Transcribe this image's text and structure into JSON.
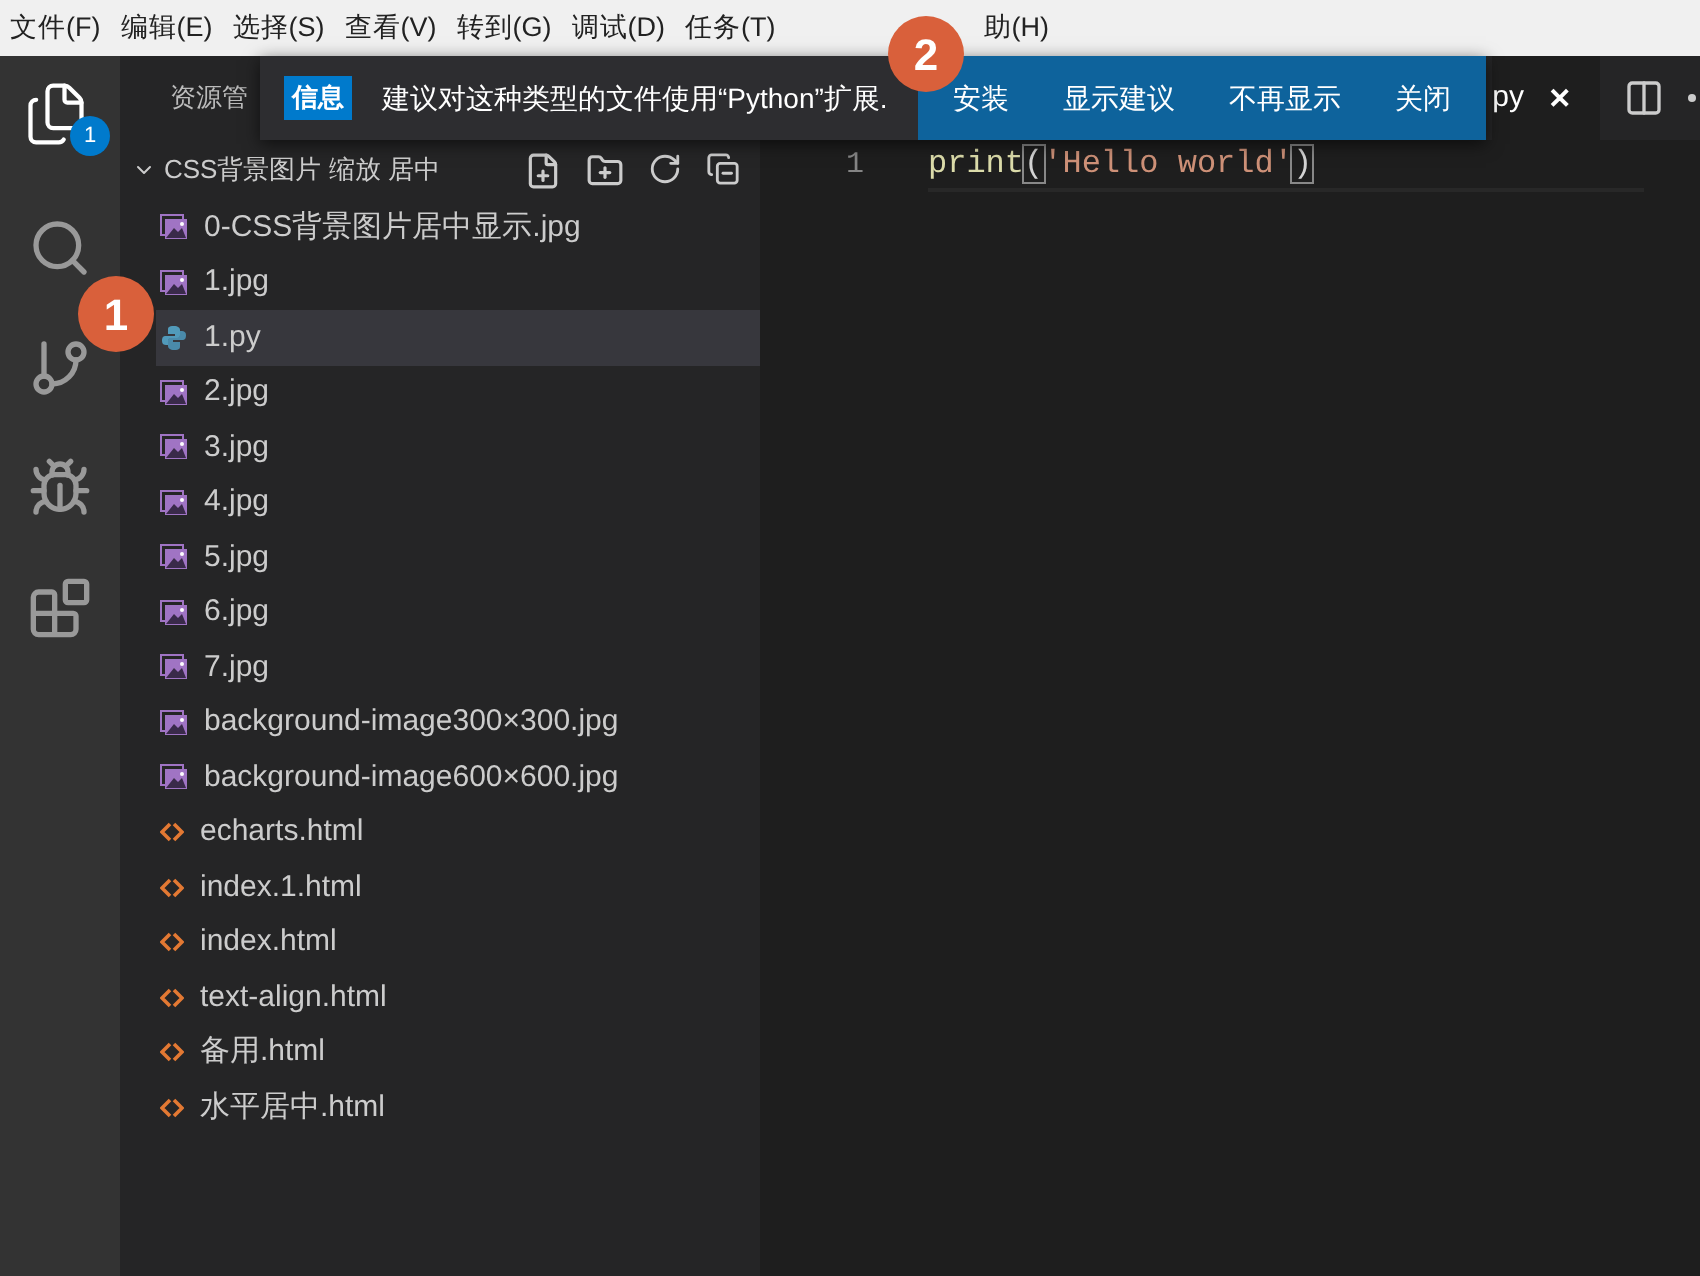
{
  "menu": [
    "文件(F)",
    "编辑(E)",
    "选择(S)",
    "查看(V)",
    "转到(G)",
    "调试(D)",
    "任务(T)",
    "助(H)"
  ],
  "activity_bar": {
    "explorer_badge": "1"
  },
  "sidebar": {
    "title": "资源管",
    "folder": {
      "name": "CSS背景图片 缩放 居中",
      "expanded": true
    },
    "files": [
      {
        "name": "0-CSS背景图片居中显示.jpg",
        "kind": "image",
        "selected": false
      },
      {
        "name": "1.jpg",
        "kind": "image",
        "selected": false
      },
      {
        "name": "1.py",
        "kind": "python",
        "selected": true
      },
      {
        "name": "2.jpg",
        "kind": "image",
        "selected": false
      },
      {
        "name": "3.jpg",
        "kind": "image",
        "selected": false
      },
      {
        "name": "4.jpg",
        "kind": "image",
        "selected": false
      },
      {
        "name": "5.jpg",
        "kind": "image",
        "selected": false
      },
      {
        "name": "6.jpg",
        "kind": "image",
        "selected": false
      },
      {
        "name": "7.jpg",
        "kind": "image",
        "selected": false
      },
      {
        "name": "background-image300×300.jpg",
        "kind": "image",
        "selected": false
      },
      {
        "name": "background-image600×600.jpg",
        "kind": "image",
        "selected": false
      },
      {
        "name": "echarts.html",
        "kind": "html",
        "selected": false
      },
      {
        "name": "index.1.html",
        "kind": "html",
        "selected": false
      },
      {
        "name": "index.html",
        "kind": "html",
        "selected": false
      },
      {
        "name": "text-align.html",
        "kind": "html",
        "selected": false
      },
      {
        "name": "备用.html",
        "kind": "html",
        "selected": false
      },
      {
        "name": "水平居中.html",
        "kind": "html",
        "selected": false
      }
    ]
  },
  "editor": {
    "tab": {
      "label": "py",
      "close": "✕"
    },
    "lines": [
      {
        "number": "1",
        "tokens": [
          {
            "text": "print",
            "kind": "function"
          },
          {
            "text": "(",
            "kind": "bracket"
          },
          {
            "text": "'Hello world'",
            "kind": "string"
          },
          {
            "text": ")",
            "kind": "bracket"
          }
        ]
      }
    ]
  },
  "notification": {
    "label": "信息",
    "message": "建议对这种类型的文件使用“Python”扩展.",
    "buttons": [
      "安装",
      "显示建议",
      "不再显示",
      "关闭"
    ]
  },
  "annotations": [
    "1",
    "2"
  ]
}
